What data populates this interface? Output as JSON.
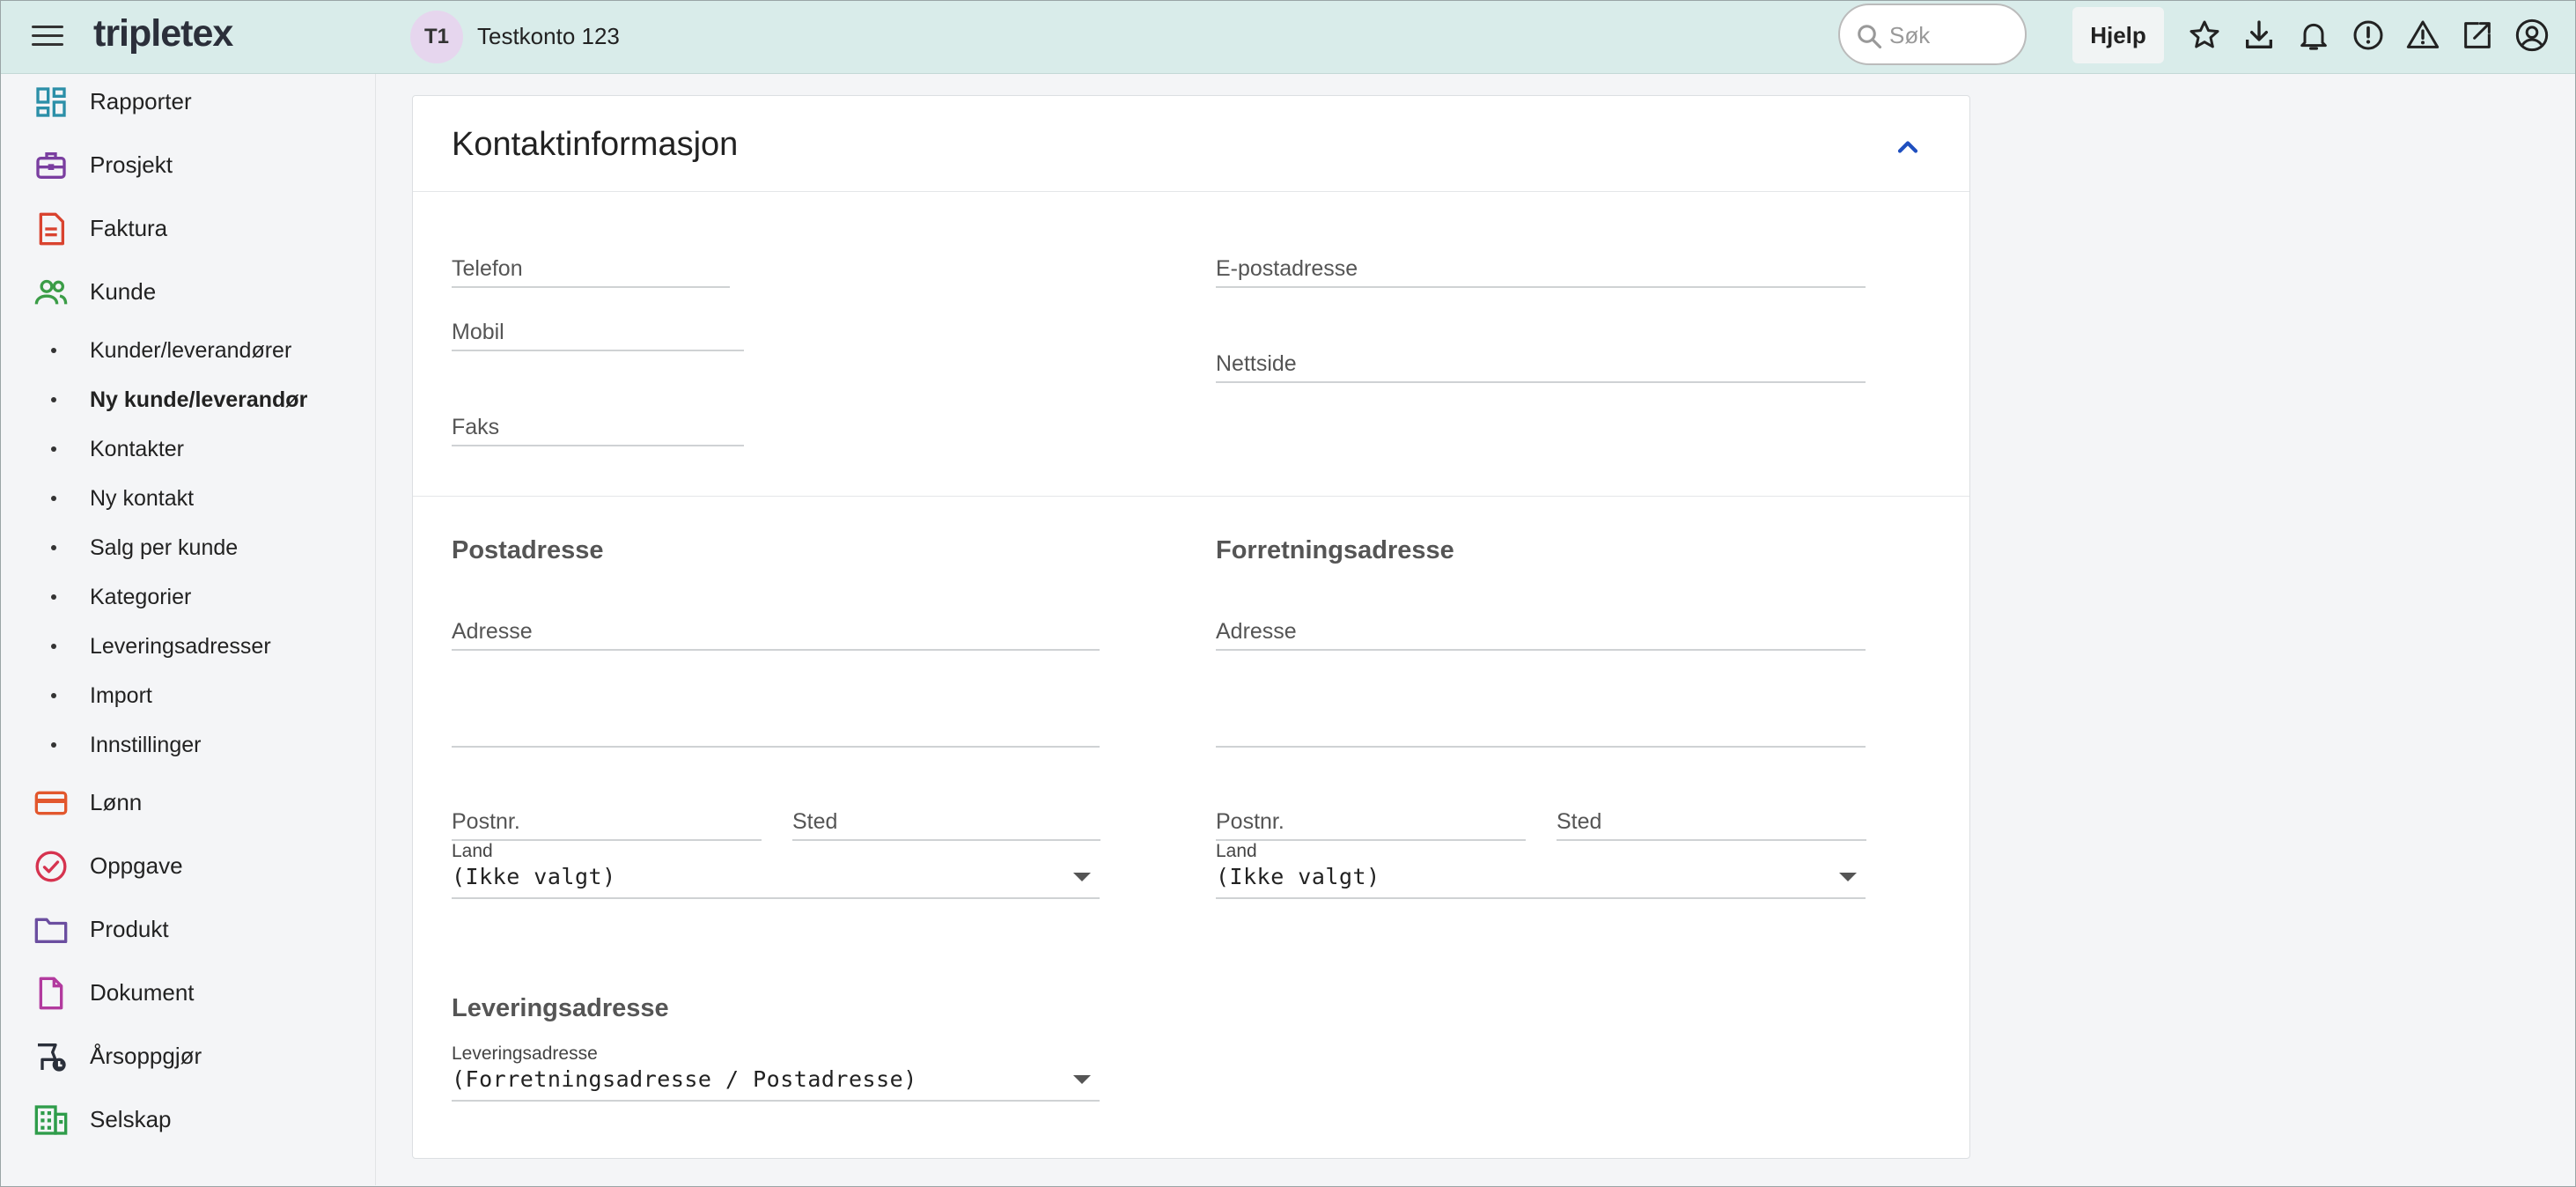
{
  "topbar": {
    "logo": "tripletex",
    "avatar_initials": "T1",
    "account_name": "Testkonto 123",
    "search_placeholder": "Søk",
    "help_label": "Hjelp",
    "icons": [
      "star-icon",
      "download-icon",
      "bell-icon",
      "info-icon",
      "warning-icon",
      "external-link-icon",
      "user-icon"
    ]
  },
  "sidebar": {
    "items": [
      {
        "label": "Rapporter",
        "icon": "dashboard-icon",
        "color": "#2b8fa8"
      },
      {
        "label": "Prosjekt",
        "icon": "briefcase-icon",
        "color": "#7a3ea0"
      },
      {
        "label": "Faktura",
        "icon": "invoice-icon",
        "color": "#d9432f"
      },
      {
        "label": "Kunde",
        "icon": "people-icon",
        "color": "#3b9d47"
      },
      {
        "label": "Lønn",
        "icon": "card-icon",
        "color": "#e2572d"
      },
      {
        "label": "Oppgave",
        "icon": "check-circle-icon",
        "color": "#d6334f"
      },
      {
        "label": "Produkt",
        "icon": "folder-icon",
        "color": "#6b4ea0"
      },
      {
        "label": "Dokument",
        "icon": "document-icon",
        "color": "#b23a9e"
      },
      {
        "label": "Årsoppgjør",
        "icon": "calendar-check-icon",
        "color": "#2a2f3a"
      },
      {
        "label": "Selskap",
        "icon": "building-icon",
        "color": "#2e9c4a"
      }
    ],
    "subitems": [
      {
        "label": "Kunder/leverandører",
        "active": false
      },
      {
        "label": "Ny kunde/leverandør",
        "active": true
      },
      {
        "label": "Kontakter",
        "active": false
      },
      {
        "label": "Ny kontakt",
        "active": false
      },
      {
        "label": "Salg per kunde",
        "active": false
      },
      {
        "label": "Kategorier",
        "active": false
      },
      {
        "label": "Leveringsadresser",
        "active": false
      },
      {
        "label": "Import",
        "active": false
      },
      {
        "label": "Innstillinger",
        "active": false
      }
    ]
  },
  "card": {
    "title": "Kontaktinformasjon",
    "contact": {
      "telefon": "Telefon",
      "epost": "E-postadresse",
      "mobil": "Mobil",
      "nettside": "Nettside",
      "faks": "Faks"
    },
    "postadresse": {
      "title": "Postadresse",
      "adresse": "Adresse",
      "postnr": "Postnr.",
      "sted": "Sted",
      "land_label": "Land",
      "land_value": "(Ikke valgt)"
    },
    "forretningsadresse": {
      "title": "Forretningsadresse",
      "adresse": "Adresse",
      "postnr": "Postnr.",
      "sted": "Sted",
      "land_label": "Land",
      "land_value": "(Ikke valgt)"
    },
    "leveringsadresse": {
      "title": "Leveringsadresse",
      "label": "Leveringsadresse",
      "value": "(Forretningsadresse / Postadresse)"
    }
  }
}
